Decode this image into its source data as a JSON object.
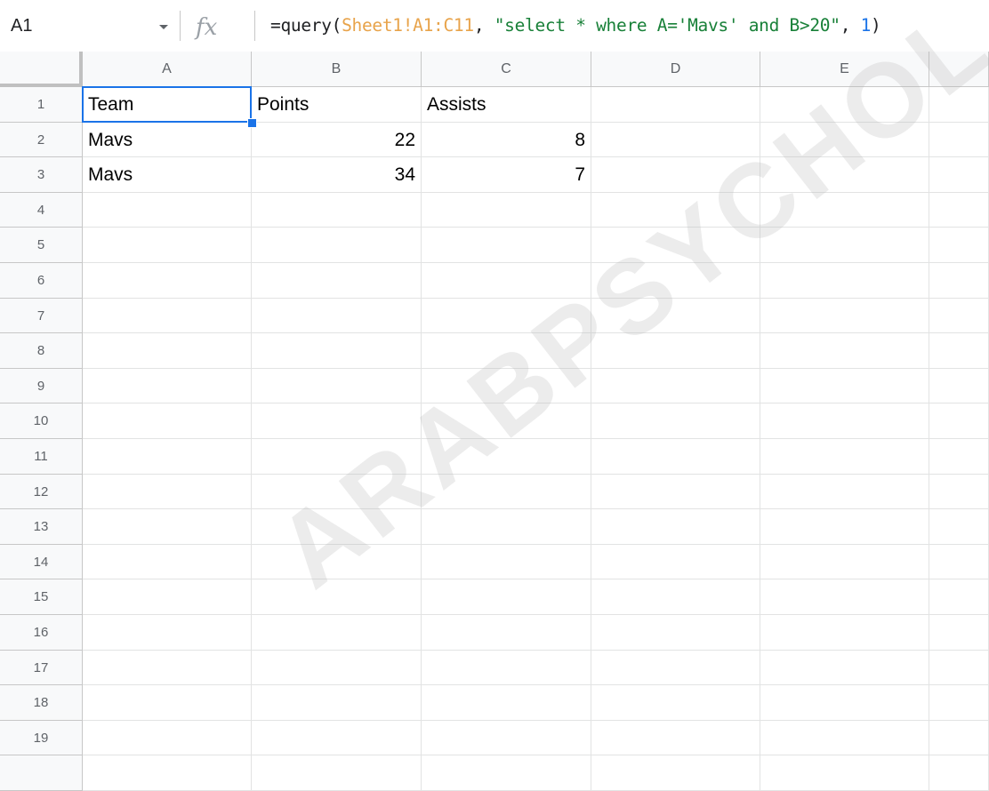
{
  "formula_bar": {
    "name_box": "A1",
    "fx_label": "fx",
    "formula_parts": {
      "fn": "=query(",
      "ref": "Sheet1!A1:C11",
      "sep1": ", ",
      "str": "\"select * where A='Mavs' and B>20\"",
      "sep2": ", ",
      "num": "1",
      "close": ")"
    }
  },
  "columns": [
    "A",
    "B",
    "C",
    "D",
    "E"
  ],
  "rows": [
    "1",
    "2",
    "3",
    "4",
    "5",
    "6",
    "7",
    "8",
    "9",
    "10",
    "11",
    "12",
    "13",
    "14",
    "15",
    "16",
    "17",
    "18",
    "19"
  ],
  "cells": {
    "A1": "Team",
    "B1": "Points",
    "C1": "Assists",
    "A2": "Mavs",
    "B2": "22",
    "C2": "8",
    "A3": "Mavs",
    "B3": "34",
    "C3": "7"
  },
  "selected_cell": "A1",
  "watermark": "ARABPSYCHOL",
  "colors": {
    "selection": "#1a73e8",
    "header_bg": "#f8f9fa",
    "range_ref": "#e8a34a",
    "string": "#188038",
    "number": "#1a73e8"
  }
}
